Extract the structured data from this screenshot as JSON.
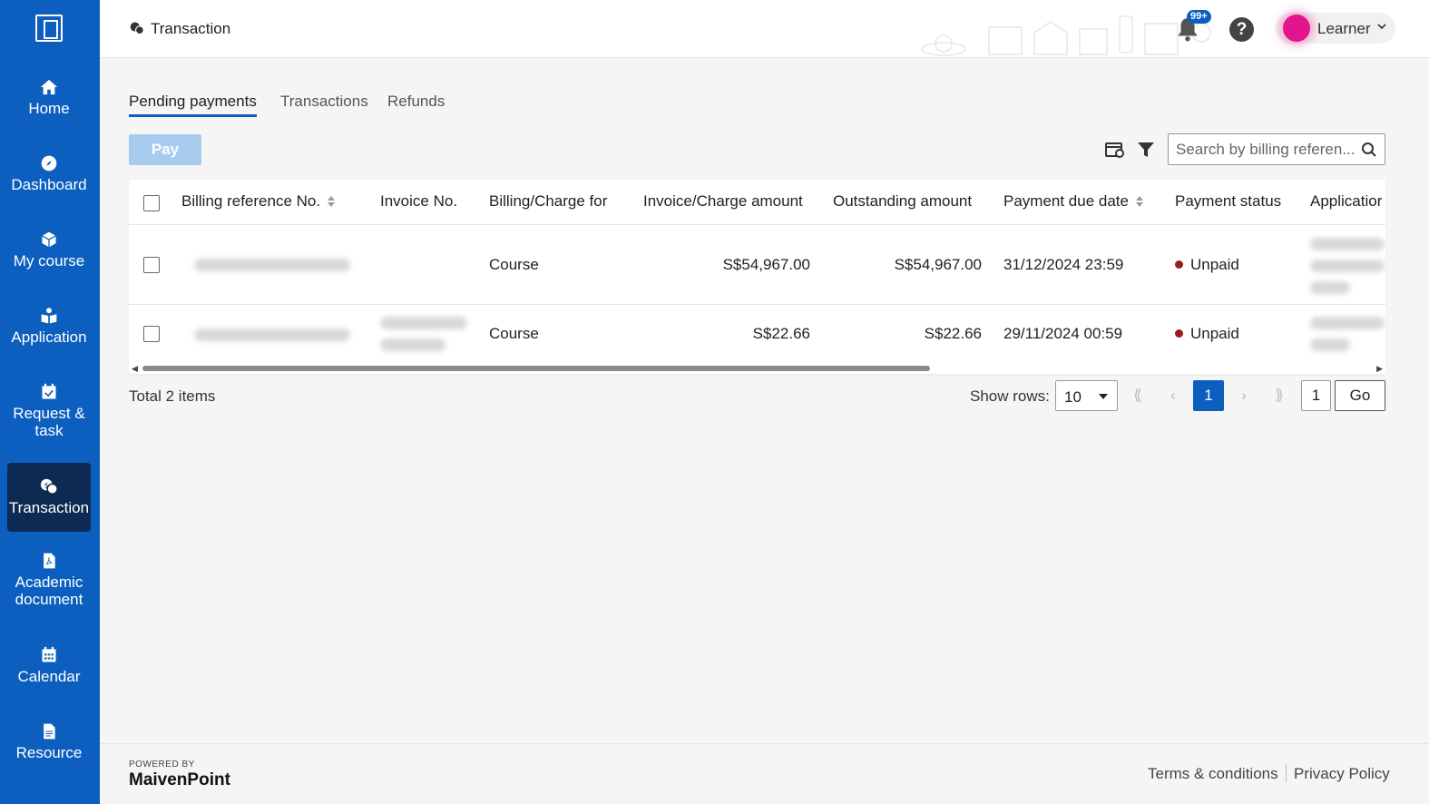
{
  "sidebar": {
    "items": [
      {
        "label": "Home",
        "icon": "home-icon"
      },
      {
        "label": "Dashboard",
        "icon": "compass-icon"
      },
      {
        "label": "My course",
        "icon": "cube-icon"
      },
      {
        "label": "Application",
        "icon": "application-icon"
      },
      {
        "label": "Request &\ntask",
        "label_line1": "Request &",
        "label_line2": "task",
        "icon": "calendar-check-icon"
      },
      {
        "label": "Transaction",
        "icon": "transaction-icon",
        "active": true
      },
      {
        "label_line1": "Academic",
        "label_line2": "document",
        "icon": "pdf-icon"
      },
      {
        "label": "Calendar",
        "icon": "calendar-icon"
      },
      {
        "label": "Resource",
        "icon": "file-icon"
      }
    ]
  },
  "header": {
    "title": "Transaction",
    "notification_badge": "99+",
    "help": "?",
    "user_name": "Learner"
  },
  "tabs": [
    "Pending payments",
    "Transactions",
    "Refunds"
  ],
  "toolbar": {
    "pay_label": "Pay",
    "search_placeholder": "Search by billing referen..."
  },
  "table": {
    "columns": [
      "Billing reference No.",
      "Invoice No.",
      "Billing/Charge for",
      "Invoice/Charge amount",
      "Outstanding amount",
      "Payment due date",
      "Payment status",
      "Applicatior"
    ],
    "rows": [
      {
        "charge_for": "Course",
        "invoice_amount": "S$54,967.00",
        "outstanding": "S$54,967.00",
        "due_date": "31/12/2024 23:59",
        "status": "Unpaid"
      },
      {
        "charge_for": "Course",
        "invoice_amount": "S$22.66",
        "outstanding": "S$22.66",
        "due_date": "29/11/2024 00:59",
        "status": "Unpaid"
      }
    ]
  },
  "pagination": {
    "total": "Total 2 items",
    "show_rows_label": "Show rows:",
    "rows_value": "10",
    "current_page": "1",
    "page_input": "1",
    "go_label": "Go"
  },
  "footer": {
    "powered_by": "POWERED BY",
    "brand": "MaivenPoint",
    "terms": "Terms & conditions",
    "privacy": "Privacy Policy"
  },
  "colors": {
    "primary": "#0d5fbf",
    "sidebar_active": "#0c2a52",
    "unpaid_dot": "#9b1b1b",
    "pay_disabled": "#a9cbee"
  }
}
